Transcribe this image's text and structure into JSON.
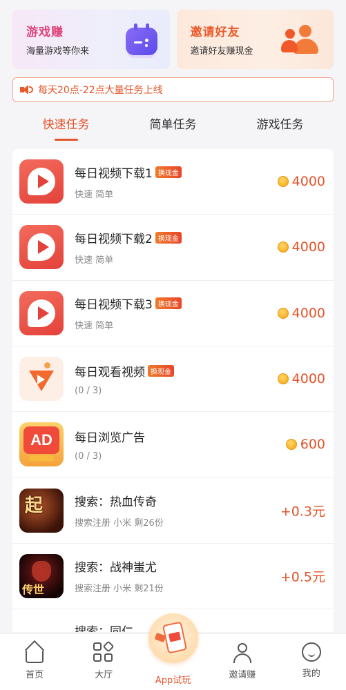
{
  "banners": [
    {
      "title": "游戏赚",
      "subtitle": "海量游戏等你来",
      "icon": "gamepad-icon"
    },
    {
      "title": "邀请好友",
      "subtitle": "邀请好友赚现金",
      "icon": "people-icon"
    }
  ],
  "notice": {
    "icon": "speaker-icon",
    "text": "每天20点-22点大量任务上线"
  },
  "tabs": [
    {
      "label": "快速任务",
      "active": true
    },
    {
      "label": "简单任务",
      "active": false
    },
    {
      "label": "游戏任务",
      "active": false
    }
  ],
  "tasks": [
    {
      "title": "每日视频下载1",
      "tag": "换现金",
      "sub": "快速 简单",
      "reward": "4000",
      "coin": true
    },
    {
      "title": "每日视频下载2",
      "tag": "换现金",
      "sub": "快速 简单",
      "reward": "4000",
      "coin": true
    },
    {
      "title": "每日视频下载3",
      "tag": "换现金",
      "sub": "快速 简单",
      "reward": "4000",
      "coin": true
    },
    {
      "title": "每日观看视频",
      "tag": "换现金",
      "sub": "(0 / 3)",
      "reward": "4000",
      "coin": true
    },
    {
      "title": "每日浏览广告",
      "tag": "",
      "sub": "(0 / 3)",
      "reward": "600",
      "coin": true,
      "icon_text": "AD"
    },
    {
      "title": "搜索：热血传奇",
      "tag": "",
      "sub": "搜索注册  小米  剩26份",
      "reward": "+0.3元",
      "coin": false,
      "icon_text": "起"
    },
    {
      "title": "搜索：战神蚩尤",
      "tag": "",
      "sub": "搜索注册  小米  剩21份",
      "reward": "+0.5元",
      "coin": false,
      "icon_text": "传世"
    },
    {
      "title": "搜索：同仁",
      "tag": "",
      "sub": "",
      "reward": "",
      "coin": false
    }
  ],
  "nav": [
    {
      "label": "首页",
      "icon": "home-icon"
    },
    {
      "label": "大厅",
      "icon": "grid-icon"
    },
    {
      "label": "App试玩",
      "icon": "app-trial-icon",
      "active": true
    },
    {
      "label": "邀请赚",
      "icon": "person-icon"
    },
    {
      "label": "我的",
      "icon": "smile-icon"
    }
  ],
  "colors": {
    "accent": "#e2542a",
    "background": "#f5f5f7"
  }
}
